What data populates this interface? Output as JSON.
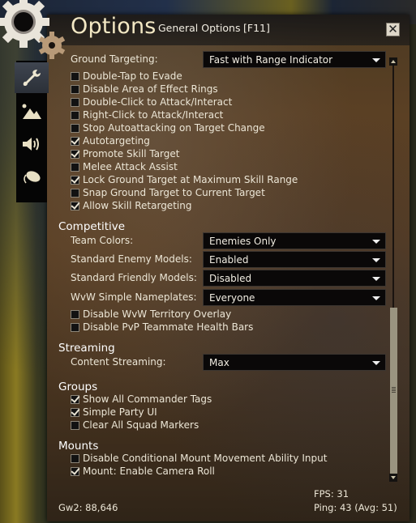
{
  "window": {
    "title": "Options",
    "subtitle": "General Options",
    "hotkey": "[F11]",
    "close_icon": "close-icon"
  },
  "side_tabs": [
    {
      "name": "general",
      "icon": "wrench-icon",
      "active": true
    },
    {
      "name": "graphics",
      "icon": "mountains-icon",
      "active": false
    },
    {
      "name": "sound",
      "icon": "speaker-icon",
      "active": false
    },
    {
      "name": "controls",
      "icon": "mouse-icon",
      "active": false
    }
  ],
  "ground_targeting": {
    "label": "Ground Targeting:",
    "value": "Fast with Range Indicator"
  },
  "combat_checkboxes": [
    {
      "label": "Double-Tap to Evade",
      "checked": false
    },
    {
      "label": "Disable Area of Effect Rings",
      "checked": false
    },
    {
      "label": "Double-Click to Attack/Interact",
      "checked": false
    },
    {
      "label": "Right-Click to Attack/Interact",
      "checked": false
    },
    {
      "label": "Stop Autoattacking on Target Change",
      "checked": false
    },
    {
      "label": "Autotargeting",
      "checked": true
    },
    {
      "label": "Promote Skill Target",
      "checked": true
    },
    {
      "label": "Melee Attack Assist",
      "checked": false
    },
    {
      "label": "Lock Ground Target at Maximum Skill Range",
      "checked": true
    },
    {
      "label": "Snap Ground Target to Current Target",
      "checked": false
    },
    {
      "label": "Allow Skill Retargeting",
      "checked": true
    }
  ],
  "competitive": {
    "heading": "Competitive",
    "selects": [
      {
        "label": "Team Colors:",
        "value": "Enemies Only"
      },
      {
        "label": "Standard Enemy Models:",
        "value": "Enabled"
      },
      {
        "label": "Standard Friendly Models:",
        "value": "Disabled"
      },
      {
        "label": "WvW Simple Nameplates:",
        "value": "Everyone"
      }
    ],
    "checkboxes": [
      {
        "label": "Disable WvW Territory Overlay",
        "checked": false
      },
      {
        "label": "Disable PvP Teammate Health Bars",
        "checked": false
      }
    ]
  },
  "streaming": {
    "heading": "Streaming",
    "label": "Content Streaming:",
    "value": "Max"
  },
  "groups": {
    "heading": "Groups",
    "checkboxes": [
      {
        "label": "Show All Commander Tags",
        "checked": true
      },
      {
        "label": "Simple Party UI",
        "checked": true
      },
      {
        "label": "Clear All Squad Markers",
        "checked": false
      }
    ]
  },
  "mounts": {
    "heading": "Mounts",
    "checkboxes": [
      {
        "label": "Disable Conditional Mount Movement Ability Input",
        "checked": false
      },
      {
        "label": "Mount: Enable Camera Roll",
        "checked": true
      }
    ]
  },
  "footer": {
    "build": "Gw2: 88,646",
    "fps": "FPS: 31",
    "ping": "Ping: 43 (Avg: 51)"
  },
  "colors": {
    "title": "#f3e8c4",
    "text": "#ece6d6",
    "select_bg": "#0a0808"
  }
}
